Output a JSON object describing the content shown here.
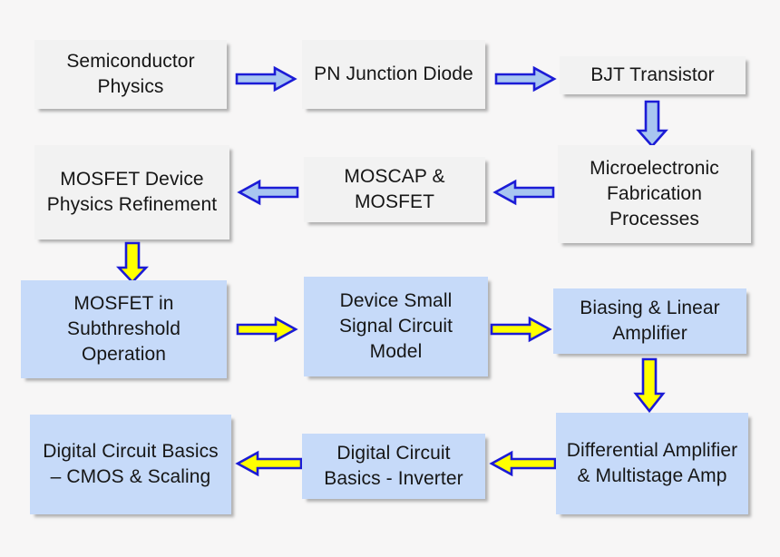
{
  "diagram": {
    "title": "Microelectronics course topic flow",
    "background_color": "#F7F6F6",
    "palette": {
      "box_gray": "#F2F2F2",
      "box_blue": "#C6DAF9",
      "arrow_blue_fill": "#A8C6F0",
      "arrow_yellow_fill": "#FFFF00",
      "arrow_outline": "#1B1BD6",
      "text": "#161616"
    },
    "nodes": [
      {
        "id": "semiconductor-physics",
        "label": "Semiconductor Physics",
        "style": "gray"
      },
      {
        "id": "pn-junction-diode",
        "label": "PN Junction Diode",
        "style": "gray"
      },
      {
        "id": "bjt-transistor",
        "label": "BJT Transistor",
        "style": "gray"
      },
      {
        "id": "microelectronic-fab",
        "label": "Microelectronic Fabrication Processes",
        "style": "gray"
      },
      {
        "id": "moscap-mosfet",
        "label": "MOSCAP & MOSFET",
        "style": "gray"
      },
      {
        "id": "mosfet-device-physics",
        "label": "MOSFET Device Physics Refinement",
        "style": "gray"
      },
      {
        "id": "mosfet-subthreshold",
        "label": "MOSFET in Subthreshold Operation",
        "style": "blue"
      },
      {
        "id": "device-small-signal",
        "label": "Device Small Signal Circuit Model",
        "style": "blue"
      },
      {
        "id": "biasing-linear-amp",
        "label": "Biasing & Linear Amplifier",
        "style": "blue"
      },
      {
        "id": "differential-amp",
        "label": "Differential Amplifier & Multistage Amp",
        "style": "blue"
      },
      {
        "id": "digital-inverter",
        "label": "Digital Circuit Basics - Inverter",
        "style": "blue"
      },
      {
        "id": "digital-cmos-scaling",
        "label": "Digital Circuit Basics – CMOS & Scaling",
        "style": "blue"
      }
    ],
    "arrows": [
      {
        "id": "semiconductor-to-pn",
        "from": "semiconductor-physics",
        "to": "pn-junction-diode",
        "direction": "right",
        "color": "blue"
      },
      {
        "id": "pn-to-bjt",
        "from": "pn-junction-diode",
        "to": "bjt-transistor",
        "direction": "right",
        "color": "blue"
      },
      {
        "id": "bjt-to-fabrication",
        "from": "bjt-transistor",
        "to": "microelectronic-fab",
        "direction": "down",
        "color": "blue"
      },
      {
        "id": "fabrication-to-moscap",
        "from": "microelectronic-fab",
        "to": "moscap-mosfet",
        "direction": "left",
        "color": "blue"
      },
      {
        "id": "moscap-to-mosfet-physics",
        "from": "moscap-mosfet",
        "to": "mosfet-device-physics",
        "direction": "left",
        "color": "blue"
      },
      {
        "id": "physics-to-subthreshold",
        "from": "mosfet-device-physics",
        "to": "mosfet-subthreshold",
        "direction": "down",
        "color": "yellow"
      },
      {
        "id": "subthreshold-to-smallsignal",
        "from": "mosfet-subthreshold",
        "to": "device-small-signal",
        "direction": "right",
        "color": "yellow"
      },
      {
        "id": "smallsignal-to-biasing",
        "from": "device-small-signal",
        "to": "biasing-linear-amp",
        "direction": "right",
        "color": "yellow"
      },
      {
        "id": "biasing-to-differential",
        "from": "biasing-linear-amp",
        "to": "differential-amp",
        "direction": "down",
        "color": "yellow"
      },
      {
        "id": "differential-to-inverter",
        "from": "differential-amp",
        "to": "digital-inverter",
        "direction": "left",
        "color": "yellow"
      },
      {
        "id": "inverter-to-cmos",
        "from": "digital-inverter",
        "to": "digital-cmos-scaling",
        "direction": "left",
        "color": "yellow"
      }
    ]
  }
}
